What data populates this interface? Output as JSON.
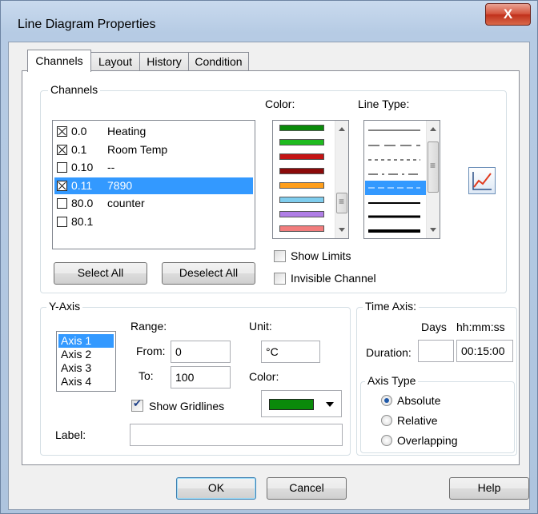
{
  "window": {
    "title": "Line Diagram Properties",
    "close_glyph": "X"
  },
  "tabs": [
    "Channels",
    "Layout",
    "History",
    "Condition"
  ],
  "channels": {
    "group_label": "Channels",
    "items": [
      {
        "checked": true,
        "number": "0.0",
        "name": "Heating"
      },
      {
        "checked": true,
        "number": "0.1",
        "name": "Room Temp"
      },
      {
        "checked": false,
        "number": "0.10",
        "name": "--"
      },
      {
        "checked": true,
        "number": "0.11",
        "name": "7890",
        "selected": true
      },
      {
        "checked": false,
        "number": "80.0",
        "name": "counter"
      },
      {
        "checked": false,
        "number": "80.1",
        "name": ""
      }
    ],
    "select_all": "Select All",
    "deselect_all": "Deselect All",
    "color_label": "Color:",
    "colors": [
      "#0a8a0a",
      "#1fbb1f",
      "#c41414",
      "#8b0a0a",
      "#ff9e1a",
      "#7fcdee",
      "#b07ee6",
      "#f27d7d"
    ],
    "line_type_label": "Line Type:",
    "show_limits": "Show Limits",
    "invisible_channel": "Invisible Channel"
  },
  "y_axis": {
    "group_label": "Y-Axis",
    "axes": [
      "Axis 1",
      "Axis 2",
      "Axis 3",
      "Axis 4"
    ],
    "selected_axis": "Axis 1",
    "range_label": "Range:",
    "from_label": "From:",
    "from_value": "0",
    "to_label": "To:",
    "to_value": "100",
    "unit_label": "Unit:",
    "unit_value": "°C",
    "color_label": "Color:",
    "axis_color": "#0a8a0a",
    "show_gridlines": "Show Gridlines",
    "label_label": "Label:",
    "label_value": ""
  },
  "time_axis": {
    "group_label": "Time Axis:",
    "days_label": "Days",
    "time_label": "hh:mm:ss",
    "duration_label": "Duration:",
    "days_value": "",
    "time_value": "00:15:00",
    "axis_type_label": "Axis Type",
    "options": [
      "Absolute",
      "Relative",
      "Overlapping"
    ],
    "selected": "Absolute"
  },
  "footer": {
    "ok": "OK",
    "cancel": "Cancel",
    "help": "Help"
  },
  "icons": {
    "chart": "line-chart-icon"
  }
}
